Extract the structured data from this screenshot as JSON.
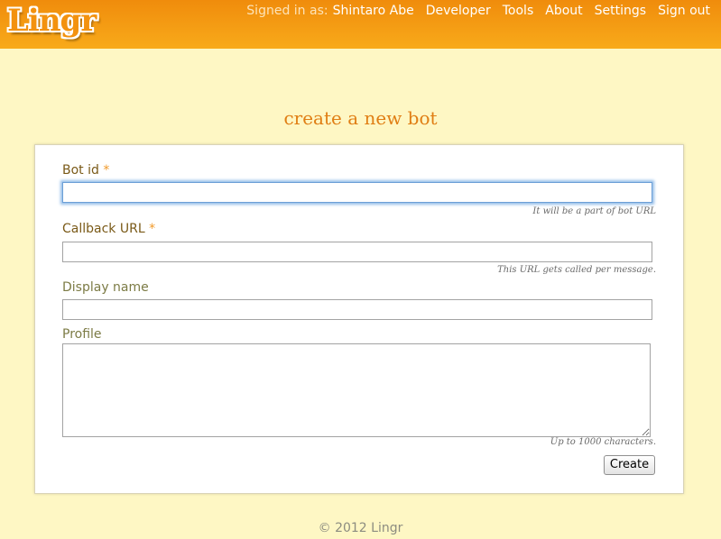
{
  "header": {
    "logo": "Lingr",
    "signed_in_label": "Signed in as:",
    "user_name": "Shintaro Abe",
    "nav": [
      "Developer",
      "Tools",
      "About",
      "Settings",
      "Sign out"
    ]
  },
  "page": {
    "title": "create a new bot"
  },
  "form": {
    "bot_id": {
      "label": "Bot id",
      "required_mark": "*",
      "value": "",
      "hint": "It will be a part of bot URL"
    },
    "callback_url": {
      "label": "Callback URL",
      "required_mark": "*",
      "value": "",
      "hint": "This URL gets called per message."
    },
    "display_name": {
      "label": "Display name",
      "value": ""
    },
    "profile": {
      "label": "Profile",
      "value": "",
      "hint": "Up to 1000 characters."
    },
    "submit_label": "Create"
  },
  "footer": {
    "text": "© 2012 Lingr"
  },
  "colors": {
    "header_start": "#f08c0c",
    "header_end": "#f8aa1a",
    "background": "#fef7c4",
    "title": "#e07e14",
    "label": "#7a5a18",
    "required": "#f19a2a"
  }
}
